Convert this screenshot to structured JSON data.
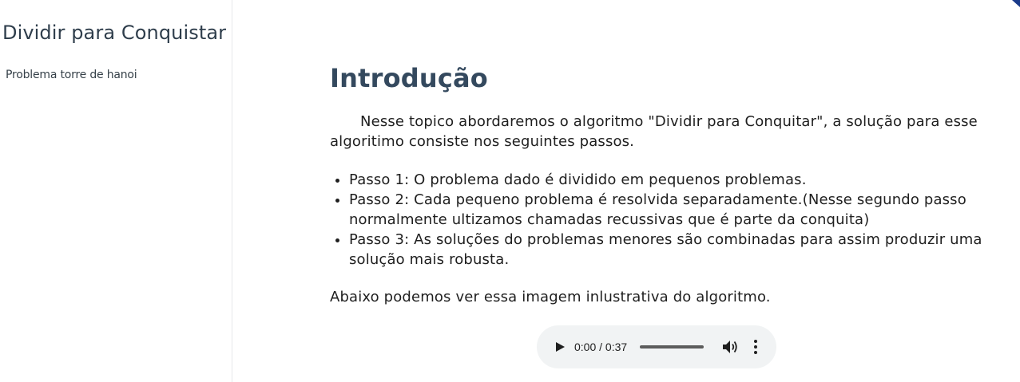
{
  "sidebar": {
    "title": "Dividir para Conquistar",
    "items": [
      {
        "label": "Problema torre de hanoi"
      }
    ]
  },
  "main": {
    "heading": "Introdução",
    "intro": "Nesse topico abordaremos o algoritmo \"Dividir para Conquitar\", a solução para esse algoritimo consiste nos seguintes passos.",
    "steps": [
      "Passo 1: O problema dado é dividido em pequenos problemas.",
      "Passo 2: Cada pequeno problema é resolvida separadamente.(Nesse segundo passo normalmente ultizamos chamadas recussivas que é parte da conquita)",
      "Passo 3: As soluções do problemas menores são combinadas para assim produzir uma solução mais robusta."
    ],
    "closing": "Abaixo podemos ver essa imagem inlustrativa do algoritmo."
  },
  "audio_player": {
    "time": "0:00 / 0:37",
    "progress": 0,
    "icons": {
      "play": "play-icon",
      "volume": "volume-icon",
      "more": "more-vertical-icon"
    }
  },
  "colors": {
    "heading": "#34495e",
    "sidebar_title": "#2f3e4c",
    "sidebar_link": "#364149",
    "ribbon": "#1a3a8a",
    "player_bg": "#f1f3f4"
  }
}
